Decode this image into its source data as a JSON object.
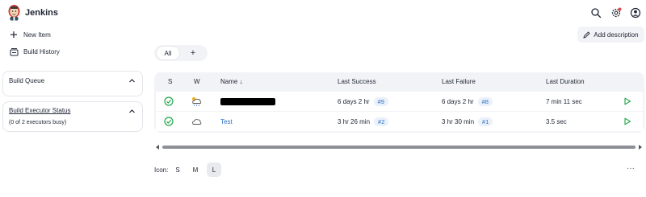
{
  "app": {
    "brand": "Jenkins"
  },
  "header": {
    "icons": [
      "search-icon",
      "gear-icon",
      "user-icon"
    ],
    "notification_color": "#e5484d"
  },
  "sidebar": {
    "links": [
      {
        "label": "New Item",
        "icon": "plus-icon"
      },
      {
        "label": "Build History",
        "icon": "history-icon"
      }
    ],
    "build_queue": {
      "title": "Build Queue"
    },
    "executor_status": {
      "title": "Build Executor Status",
      "subtitle": "(0 of 2 executors busy)"
    }
  },
  "main": {
    "add_description": "Add description",
    "tabs": [
      {
        "label": "All"
      },
      {
        "label": "+"
      }
    ],
    "table": {
      "headers": {
        "s": "S",
        "w": "W",
        "name": "Name ↓",
        "last_success": "Last Success",
        "last_failure": "Last Failure",
        "last_duration": "Last Duration"
      },
      "rows": [
        {
          "name": "",
          "name_redacted": true,
          "status_icon": "success-icon",
          "weather_icon": "rain-cloud-icon",
          "last_success": "6 days 2 hr",
          "success_build": "#9",
          "last_failure": "6 days 2 hr",
          "failure_build": "#8",
          "last_duration": "7 min 11 sec"
        },
        {
          "name": "Test",
          "name_redacted": false,
          "status_icon": "success-icon",
          "weather_icon": "cloud-icon",
          "last_success": "3 hr 26 min",
          "success_build": "#2",
          "last_failure": "3 hr 30 min",
          "failure_build": "#1",
          "last_duration": "3.5 sec"
        }
      ]
    },
    "icon_size": {
      "label": "Icon:",
      "options": [
        "S",
        "M",
        "L"
      ],
      "selected": "L"
    },
    "more": "···"
  },
  "colors": {
    "success": "#1ea446",
    "link": "#2f6fc4",
    "run": "#1ea446"
  }
}
